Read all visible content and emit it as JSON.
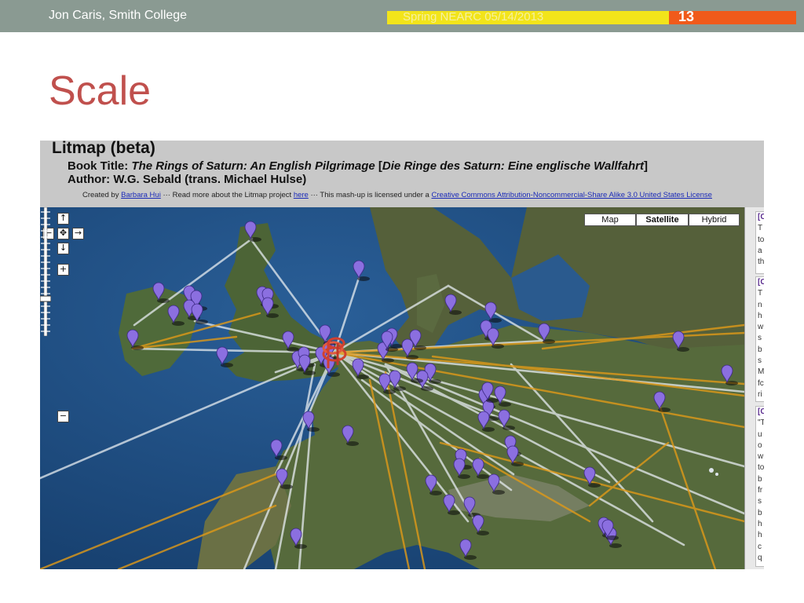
{
  "slide": {
    "author": "Jon Caris, Smith College",
    "event": "Spring NEARC 05/14/2013",
    "page_number": "13",
    "title": "Scale"
  },
  "litmap": {
    "title": "Litmap (beta)",
    "book_label": "Book Title:",
    "book_title": "The Rings of Saturn: An English Pilgrimage",
    "book_original": "Die Ringe des Saturn: Eine englische Wallfahrt",
    "author_line": "Author: W.G. Sebald (trans. Michael Hulse)",
    "credit": {
      "created_by": "Created by",
      "creator_link": "Barbara Hui",
      "read_more": "··· Read more about the Litmap project",
      "here_link": "here",
      "license_text": "··· This mash-up is licensed under a",
      "license_link": "Creative Commons Attribution-Noncommercial-Share Alike 3.0 United States License"
    }
  },
  "map_controls": {
    "types": [
      "Map",
      "Satellite",
      "Hybrid"
    ],
    "active_type": "Satellite",
    "pan": {
      "up": "↑",
      "left": "←",
      "center": "✥",
      "right": "→",
      "down": "↓"
    },
    "zoom_in": "+",
    "zoom_out": "−"
  },
  "sidebar": {
    "cards": [
      {
        "header": "[C",
        "lines": [
          "T",
          "to",
          "a",
          "th"
        ]
      },
      {
        "header": "[C",
        "lines": [
          "T",
          "n",
          "h",
          "w",
          "s",
          "b",
          "s",
          "M",
          "fc",
          "ri"
        ]
      },
      {
        "header": "[C",
        "lines": [
          "\"T",
          "u",
          "o",
          "w",
          "to",
          "b",
          "fr",
          "s",
          "b",
          "h",
          "h",
          "c",
          "q"
        ]
      }
    ]
  },
  "colors": {
    "header_bar": "#8a9a92",
    "header_yellow": "#f2e41a",
    "header_orange": "#f05a1a",
    "title_red": "#c0504d",
    "marker_purple": "#8b6fe0",
    "route_white": "#e6ecf0",
    "route_orange": "#e09a18",
    "sea": "#1f4f85",
    "land": "#4e5e38"
  },
  "icons": {
    "marker": "map-pin-icon",
    "cluster": "red-pin-cluster-icon"
  }
}
